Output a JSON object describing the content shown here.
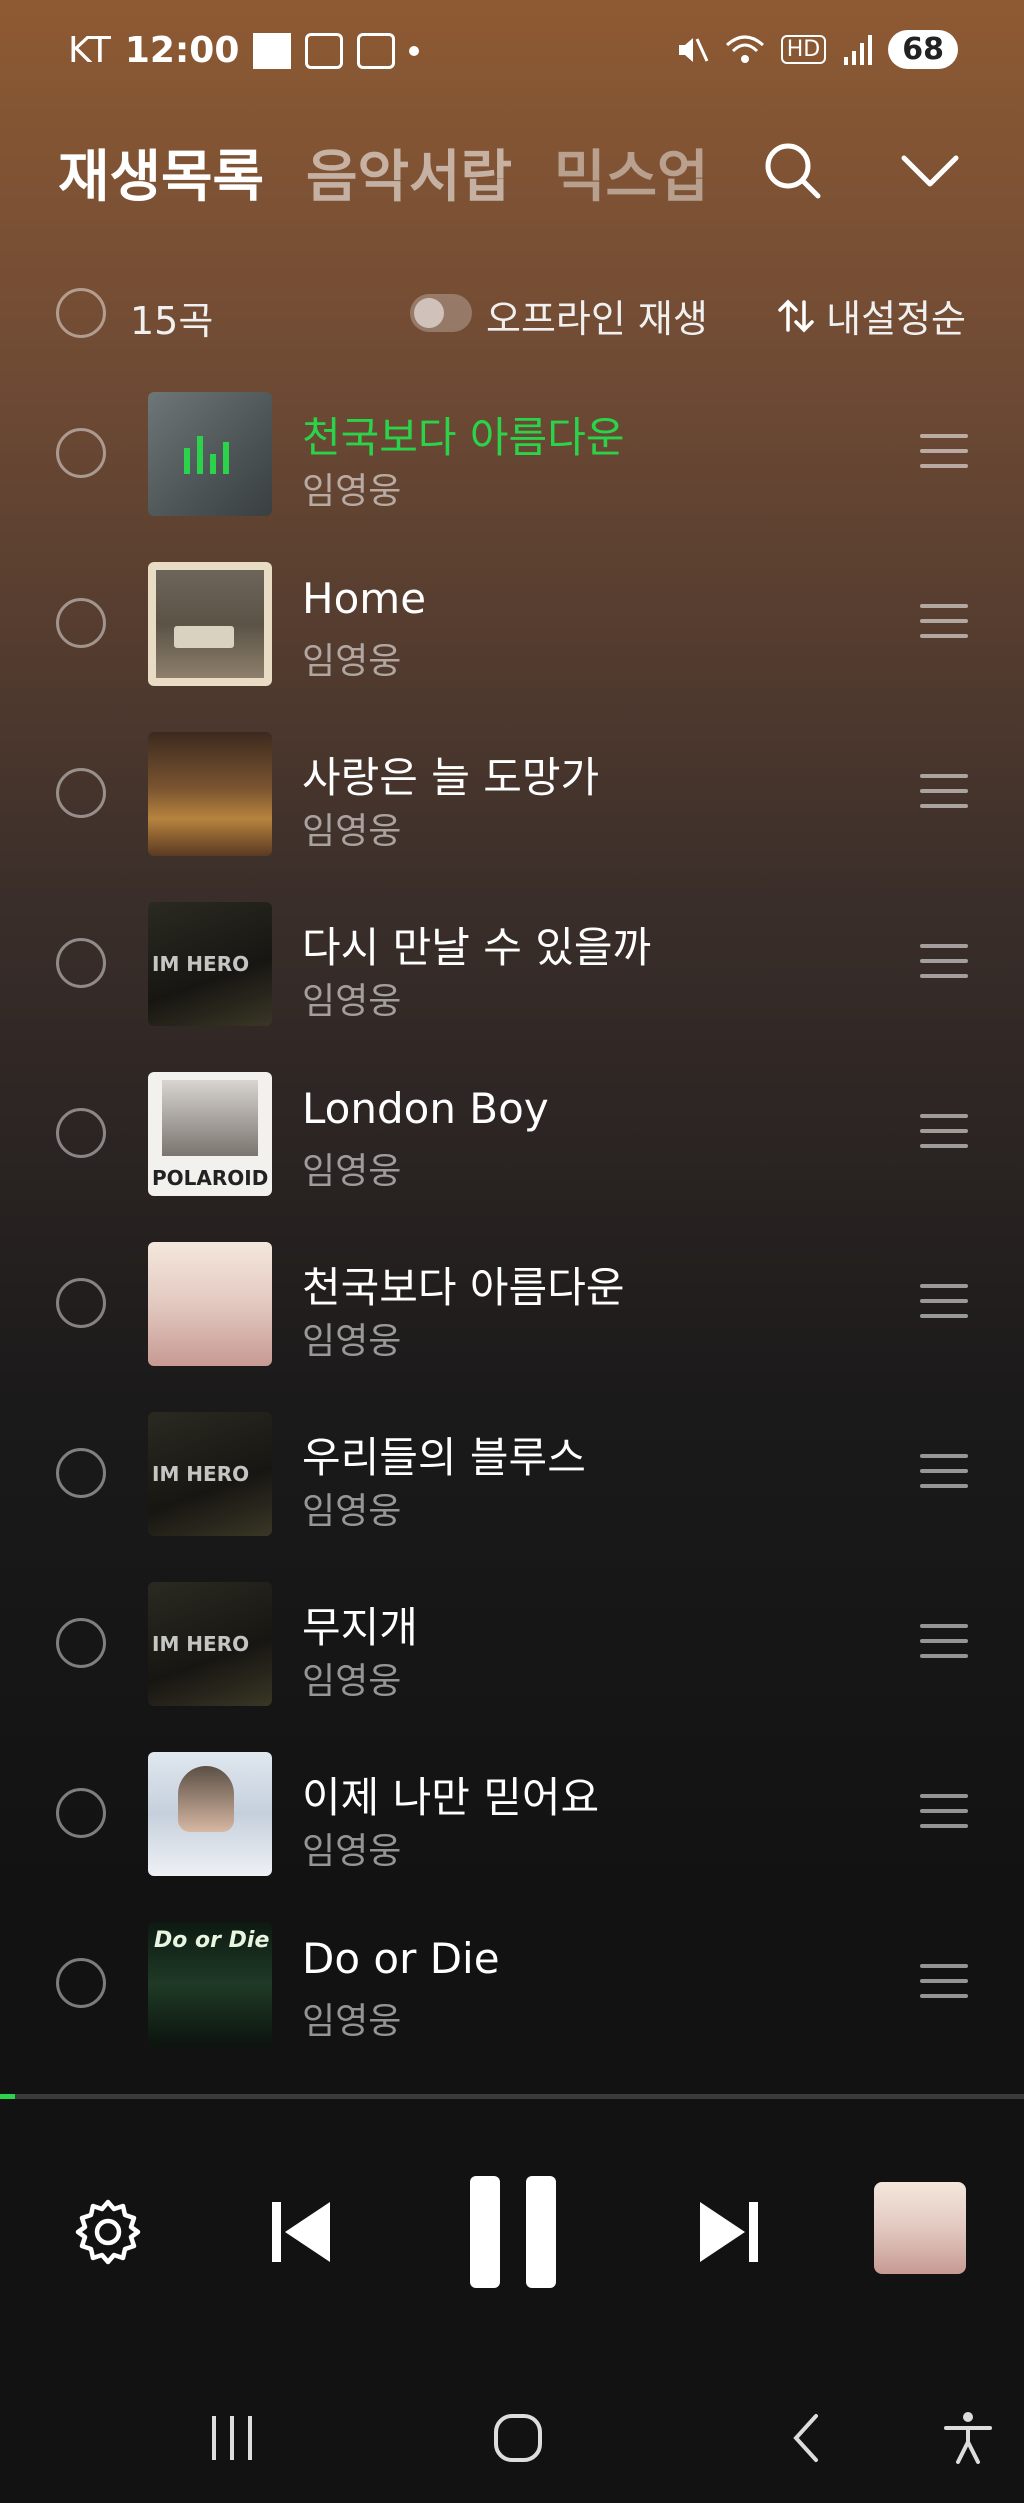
{
  "status_bar": {
    "carrier": "KT",
    "time": "12:00",
    "network": "HD",
    "battery": "68"
  },
  "tabs": [
    {
      "label": "재생목록",
      "active": true
    },
    {
      "label": "음악서랍",
      "active": false
    },
    {
      "label": "믹스업",
      "active": false
    }
  ],
  "list_header": {
    "count": "15곡",
    "offline_label": "오프라인 재생",
    "offline_enabled": false,
    "sort_label": "내설정순"
  },
  "songs": [
    {
      "title": "천국보다 아름다운",
      "artist": "임영웅",
      "playing": true
    },
    {
      "title": "Home",
      "artist": "임영웅",
      "playing": false
    },
    {
      "title": "사랑은 늘 도망가",
      "artist": "임영웅",
      "playing": false
    },
    {
      "title": "다시 만날 수 있을까",
      "artist": "임영웅",
      "playing": false
    },
    {
      "title": "London Boy",
      "artist": "임영웅",
      "playing": false
    },
    {
      "title": "천국보다 아름다운",
      "artist": "임영웅",
      "playing": false
    },
    {
      "title": "우리들의 블루스",
      "artist": "임영웅",
      "playing": false
    },
    {
      "title": "무지개",
      "artist": "임영웅",
      "playing": false
    },
    {
      "title": "이제 나만 믿어요",
      "artist": "임영웅",
      "playing": false
    },
    {
      "title": "Do or Die",
      "artist": "임영웅",
      "playing": false
    }
  ],
  "album_art_text": {
    "im_hero": "IM HERO",
    "polaroid": "POLAROID",
    "do_or_die": "Do or Die"
  },
  "player": {
    "progress": 0.015,
    "state": "playing"
  },
  "colors": {
    "accent": "#2bd34a",
    "background_top": "#8e5a33",
    "background_bottom": "#121212"
  },
  "icons": [
    "search-icon",
    "chevron-down-icon",
    "sort-icon",
    "drag-handle-icon",
    "settings-icon",
    "previous-icon",
    "pause-icon",
    "next-icon",
    "recents-icon",
    "home-icon",
    "back-icon",
    "accessibility-icon"
  ]
}
